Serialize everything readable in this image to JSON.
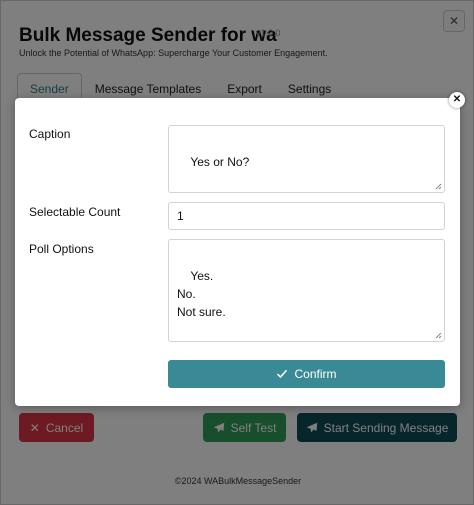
{
  "app": {
    "title": "Bulk Message Sender for wa",
    "version": "v1.0.0",
    "subtitle": "Unlock the Potential of WhatsApp: Supercharge Your Customer Engagement.",
    "close_glyph": "✕",
    "tabs": [
      {
        "label": "Sender",
        "active": true
      },
      {
        "label": "Message Templates",
        "active": false
      },
      {
        "label": "Export",
        "active": false
      },
      {
        "label": "Settings",
        "active": false
      }
    ],
    "buttons": {
      "cancel": {
        "label": "Cancel",
        "icon": "x-icon",
        "glyph": "✕",
        "color": "#dc3545"
      },
      "self_test": {
        "label": "Self Test",
        "icon": "paper-plane-icon",
        "color": "#2f9e5b"
      },
      "start": {
        "label": "Start Sending Message",
        "icon": "paper-plane-icon",
        "color": "#0f4d56"
      }
    },
    "footer": "©2024 WABulkMessageSender"
  },
  "modal": {
    "close_glyph": "✕",
    "caption": {
      "label": "Caption",
      "value": "Yes or No?"
    },
    "selectable_count": {
      "label": "Selectable Count",
      "value": "1"
    },
    "poll_options": {
      "label": "Poll Options",
      "value": "Yes.\nNo.\nNot sure."
    },
    "confirm": {
      "label": "Confirm",
      "icon": "check-icon",
      "color": "#3a8a96"
    }
  },
  "overlay_color": "rgba(0,0,0,0.5)"
}
